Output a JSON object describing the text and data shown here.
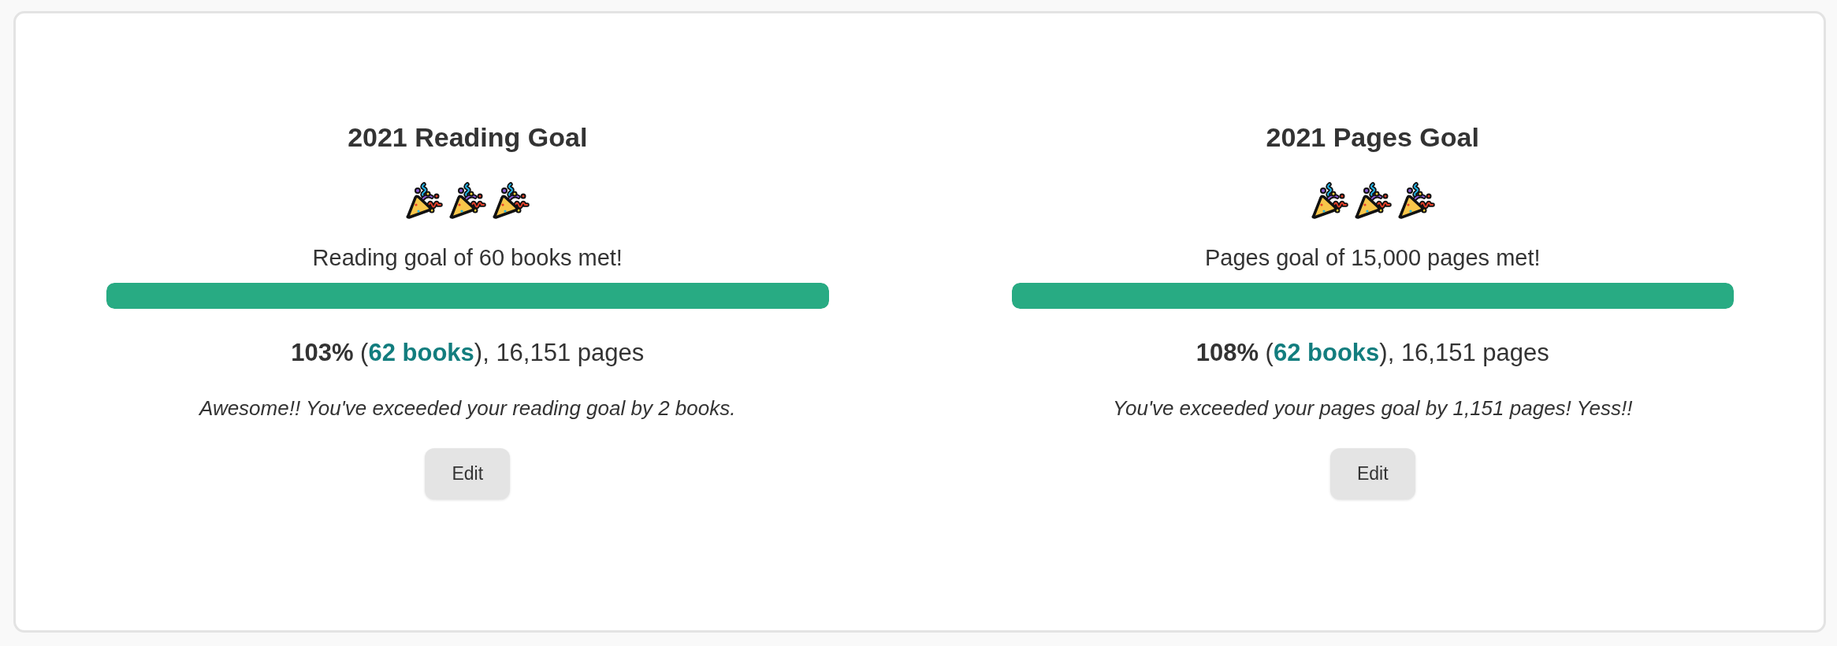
{
  "goals": [
    {
      "title": "2021 Reading Goal",
      "met": true,
      "message": "Reading goal of 60 books met!",
      "level": 1,
      "summary_before": "**103%** (",
      "summary_link": "62 books",
      "summary_after": "), 16,151 pages",
      "note": "Awesome!! You've exceeded your reading goal by 2 books.",
      "button": "Edit"
    },
    {
      "title": "2021 Pages Goal",
      "met": true,
      "message": "Pages goal of 15,000 pages met!",
      "level": 1,
      "summary_before": "**108%** (",
      "summary_link": "62 books",
      "summary_after": "), 16,151 pages",
      "note": "You've exceeded your pages goal by 1,151 pages! Yess!!",
      "button": "Edit"
    }
  ]
}
